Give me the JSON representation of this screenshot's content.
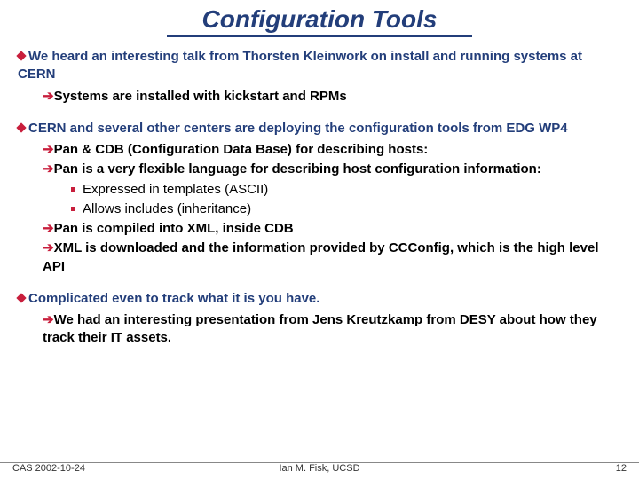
{
  "title": "Configuration Tools",
  "b1": {
    "main": "We heard an interesting talk from Thorsten Kleinwork on install and running systems at CERN",
    "sub1": "Systems are installed with kickstart and RPMs"
  },
  "b2": {
    "main": "CERN and several other centers are deploying the configuration tools from EDG WP4",
    "sub1": "Pan & CDB (Configuration Data Base) for describing hosts:",
    "sub2": "Pan is a very flexible language for describing host configuration information:",
    "sub2a": "Expressed in templates (ASCII)",
    "sub2b": "Allows includes (inheritance)",
    "sub3": "Pan is compiled into XML, inside CDB",
    "sub4": "XML is downloaded and the information provided by CCConfig, which is the high level API"
  },
  "b3": {
    "main": "Complicated even to track what it is you have.",
    "sub1": "We had an interesting presentation from Jens Kreutzkamp from DESY about how they track their IT assets."
  },
  "footer": {
    "left": "CAS 2002-10-24",
    "center": "Ian M. Fisk, UCSD",
    "right": "12"
  }
}
